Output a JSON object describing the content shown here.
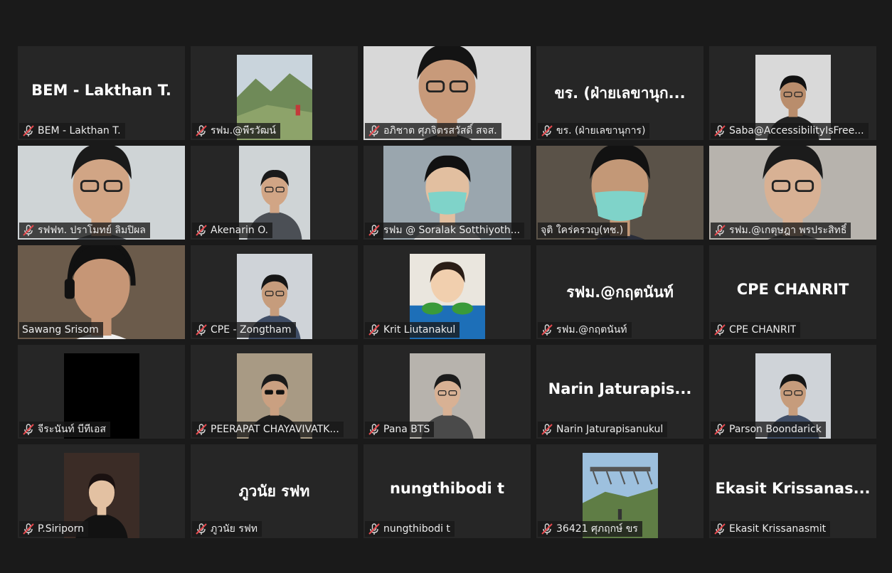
{
  "colors": {
    "background": "#1a1a1a",
    "tile": "#262626",
    "active_speaker_border": "#c8ea8a",
    "muted_icon": "#e5484d"
  },
  "participants": [
    {
      "name": "BEM - Lakthan T.",
      "display": "BEM - Lakthan T.",
      "video": false,
      "muted": true
    },
    {
      "name": "รฟม.@พีรวัฒน์",
      "video": true,
      "scene": "mountain-landscape",
      "muted": true
    },
    {
      "name": "อภิชาต ศุภจิตรสวัสดิ์ สจส.",
      "video": true,
      "scene": "person-camera",
      "muted": true
    },
    {
      "name": "ขร. (ฝ่ายเลขานุการ)",
      "display": "ขร. (ฝ่ายเลขานุก...",
      "video": false,
      "muted": true
    },
    {
      "name": "Saba@AccessibilityIsFree...",
      "video": true,
      "scene": "speaker-portrait",
      "muted": true
    },
    {
      "name": "รฟฟท. ปราโมทย์ ลิมปิผล",
      "video": true,
      "scene": "person-office",
      "muted": true
    },
    {
      "name": "Akenarin O.",
      "video": true,
      "scene": "person-office",
      "muted": true
    },
    {
      "name": "รฟม @ Soralak Sotthiyoth...",
      "video": true,
      "scene": "person-mountain-bg",
      "muted": true
    },
    {
      "name": "จุติ ใคร่ครวญ(ทช.)",
      "video": true,
      "scene": "person-mask",
      "muted": false,
      "active": true
    },
    {
      "name": "รฟม.@เกตุษฎา พรประสิทธิ์",
      "video": true,
      "scene": "person-glasses",
      "muted": true
    },
    {
      "name": "Sawang Srisom",
      "video": true,
      "scene": "person-headset",
      "muted": false
    },
    {
      "name": "CPE - Zongtham",
      "video": true,
      "scene": "person-portrait",
      "muted": true
    },
    {
      "name": "Krit Liutanakul",
      "video": true,
      "scene": "child-photo",
      "muted": true
    },
    {
      "name": "รฟม.@กฤตนันท์",
      "display": "รฟม.@กฤตนันท์",
      "video": false,
      "muted": true
    },
    {
      "name": "CPE CHANRIT",
      "display": "CPE CHANRIT",
      "video": false,
      "muted": true
    },
    {
      "name": "จีระนันท์ บีทีเอส",
      "video": true,
      "scene": "black",
      "muted": true
    },
    {
      "name": "PEERAPAT CHAYAVIVATK...",
      "video": true,
      "scene": "person-sunglasses",
      "muted": true
    },
    {
      "name": "Pana BTS",
      "video": true,
      "scene": "person-glasses",
      "muted": true
    },
    {
      "name": "Narin Jaturapisanukul",
      "display": "Narin  Jaturapis...",
      "video": false,
      "muted": true
    },
    {
      "name": "Parson Boondarick",
      "video": true,
      "scene": "person-portrait",
      "muted": true
    },
    {
      "name": "P.Siriporn",
      "video": true,
      "scene": "person-standing",
      "muted": true
    },
    {
      "name": "ภูวนัย รฟท",
      "display": "ภูวนัย  รฟท",
      "video": false,
      "muted": true
    },
    {
      "name": "nungthibodi t",
      "display": "nungthibodi t",
      "video": false,
      "muted": true
    },
    {
      "name": "36421 ศุภฤกษ์ ขร",
      "video": true,
      "scene": "bridge-landscape",
      "muted": true
    },
    {
      "name": "Ekasit Krissanasmit",
      "display": "Ekasit  Krissanas...",
      "video": false,
      "muted": true
    }
  ]
}
